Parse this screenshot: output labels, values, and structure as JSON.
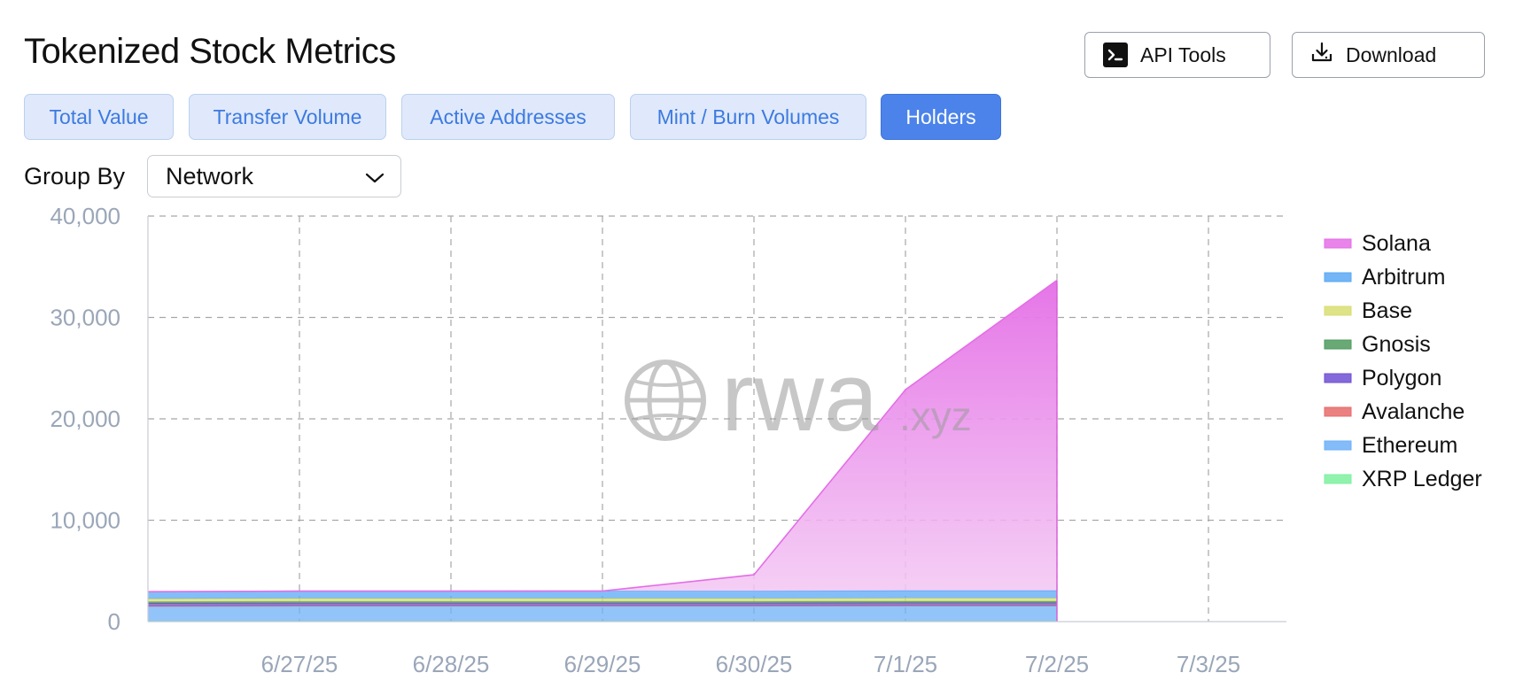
{
  "header": {
    "title": "Tokenized Stock Metrics",
    "api_tools_label": "API Tools",
    "download_label": "Download"
  },
  "tabs": [
    {
      "label": "Total Value",
      "active": false
    },
    {
      "label": "Transfer Volume",
      "active": false
    },
    {
      "label": "Active Addresses",
      "active": false
    },
    {
      "label": "Mint / Burn Volumes",
      "active": false
    },
    {
      "label": "Holders",
      "active": true
    }
  ],
  "group_by": {
    "label": "Group By",
    "selected": "Network"
  },
  "watermark": {
    "text": "rwa",
    "suffix": ".xyz"
  },
  "colors": {
    "accent": "#4b83ea",
    "tab_bg": "#dfe9fb",
    "tab_text": "#3d7ae0"
  },
  "chart_data": {
    "type": "area",
    "stacked": true,
    "x": [
      "6/26/25",
      "6/27/25",
      "6/28/25",
      "6/29/25",
      "6/30/25",
      "7/1/25",
      "7/2/25"
    ],
    "x_tick_labels": [
      "6/27/25",
      "6/28/25",
      "6/29/25",
      "6/30/25",
      "7/1/25",
      "7/2/25",
      "7/3/25"
    ],
    "xlim": [
      "6/26/25",
      "7/3/25"
    ],
    "ylim": [
      0,
      40000
    ],
    "y_ticks": [
      "0",
      "10,000",
      "20,000",
      "30,000",
      "40,000"
    ],
    "grid": true,
    "legend_position": "right",
    "series": [
      {
        "name": "Solana",
        "color": "#e46ee6",
        "values": [
          0,
          0,
          0,
          0,
          1600,
          19800,
          30600
        ]
      },
      {
        "name": "Arbitrum",
        "color": "#5aa8f5",
        "values": [
          700,
          720,
          720,
          730,
          730,
          750,
          750
        ]
      },
      {
        "name": "Base",
        "color": "#d8de72",
        "values": [
          300,
          310,
          310,
          310,
          310,
          320,
          320
        ]
      },
      {
        "name": "Gnosis",
        "color": "#4e9a5e",
        "values": [
          150,
          150,
          150,
          150,
          150,
          150,
          150
        ]
      },
      {
        "name": "Polygon",
        "color": "#6f4fd3",
        "values": [
          250,
          250,
          250,
          250,
          250,
          250,
          250
        ]
      },
      {
        "name": "Avalanche",
        "color": "#e86a6a",
        "values": [
          50,
          50,
          50,
          50,
          50,
          50,
          50
        ]
      },
      {
        "name": "Ethereum",
        "color": "#6db0f7",
        "values": [
          1450,
          1480,
          1480,
          1480,
          1480,
          1500,
          1500
        ]
      },
      {
        "name": "XRP Ledger",
        "color": "#7ef0a0",
        "values": [
          50,
          50,
          50,
          50,
          50,
          50,
          50
        ]
      }
    ]
  }
}
